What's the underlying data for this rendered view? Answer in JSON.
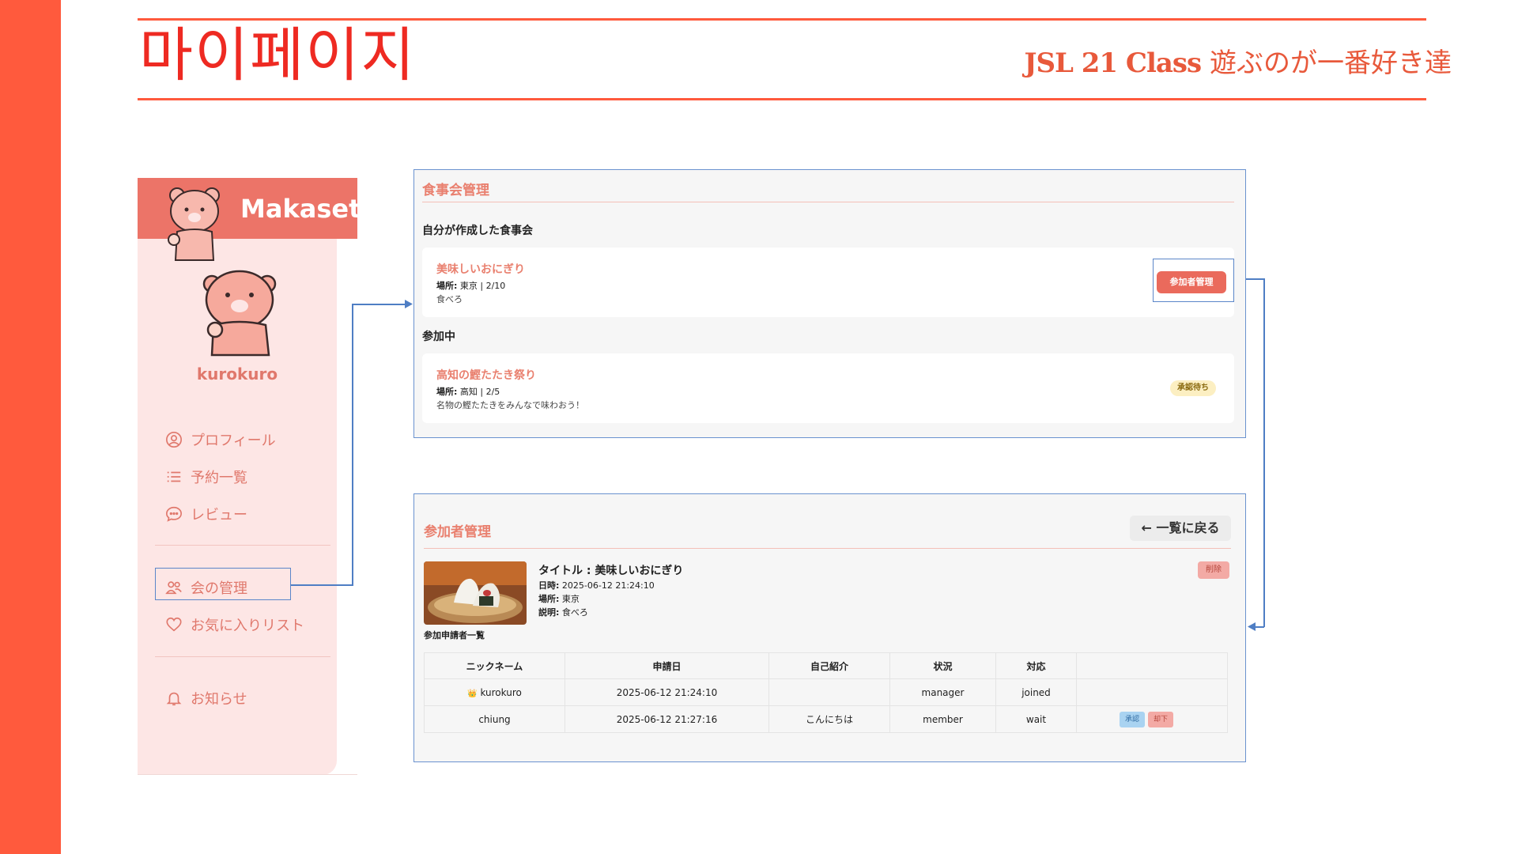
{
  "header": {
    "page_title": "마이페이지",
    "subtitle_class": "JSL 21 Class",
    "subtitle_group": "遊ぶのが一番好き達"
  },
  "sidebar": {
    "brand": "Makaset",
    "username": "kurokuro",
    "items": [
      {
        "label": "プロフィール",
        "icon": "user-circle-icon"
      },
      {
        "label": "予約一覧",
        "icon": "list-icon"
      },
      {
        "label": "レビュー",
        "icon": "chat-icon"
      },
      {
        "label": "会の管理",
        "icon": "group-icon"
      },
      {
        "label": "お気に入りリスト",
        "icon": "heart-icon"
      },
      {
        "label": "お知らせ",
        "icon": "bell-icon"
      }
    ]
  },
  "meal_panel": {
    "title": "食事会管理",
    "created_label": "自分が作成した食事会",
    "created_event": {
      "title": "美味しいおにぎり",
      "place_key": "場所:",
      "place_value": "東京 | 2/10",
      "description": "食べろ",
      "button": "参加者管理"
    },
    "joining_label": "参加中",
    "joining_event": {
      "title": "高知の鰹たたき祭り",
      "place_key": "場所:",
      "place_value": "高知 | 2/5",
      "description": "名物の鰹たたきをみんなで味わおう！",
      "badge": "承認待ち"
    }
  },
  "participant_panel": {
    "title": "参加者管理",
    "back_button": "← 一覧に戻る",
    "delete_button": "削除",
    "event_title": "タイトル : 美味しいおにぎり",
    "date_key": "日時:",
    "date_value": "2025-06-12 21:24:10",
    "place_key": "場所:",
    "place_value": "東京",
    "desc_key": "説明:",
    "desc_value": "食べろ",
    "applicants_label": "参加申請者一覧",
    "table": {
      "headers": [
        "ニックネーム",
        "申請日",
        "自己紹介",
        "状況",
        "対応",
        ""
      ],
      "rows": [
        {
          "nickname": "kurokuro",
          "date": "2025-06-12 21:24:10",
          "intro": "",
          "role": "manager",
          "status": "joined"
        },
        {
          "nickname": "chiung",
          "date": "2025-06-12 21:27:16",
          "intro": "こんにちは",
          "role": "member",
          "status": "wait",
          "approve": "承認",
          "reject": "却下"
        }
      ]
    }
  },
  "colors": {
    "accent": "#ff5a3d",
    "title_red": "#ee2a22",
    "sidebar_bg": "#fde6e5",
    "brand_bar": "#ec7468",
    "text_pink": "#e0786c",
    "highlight_blue": "#5b86c9"
  }
}
